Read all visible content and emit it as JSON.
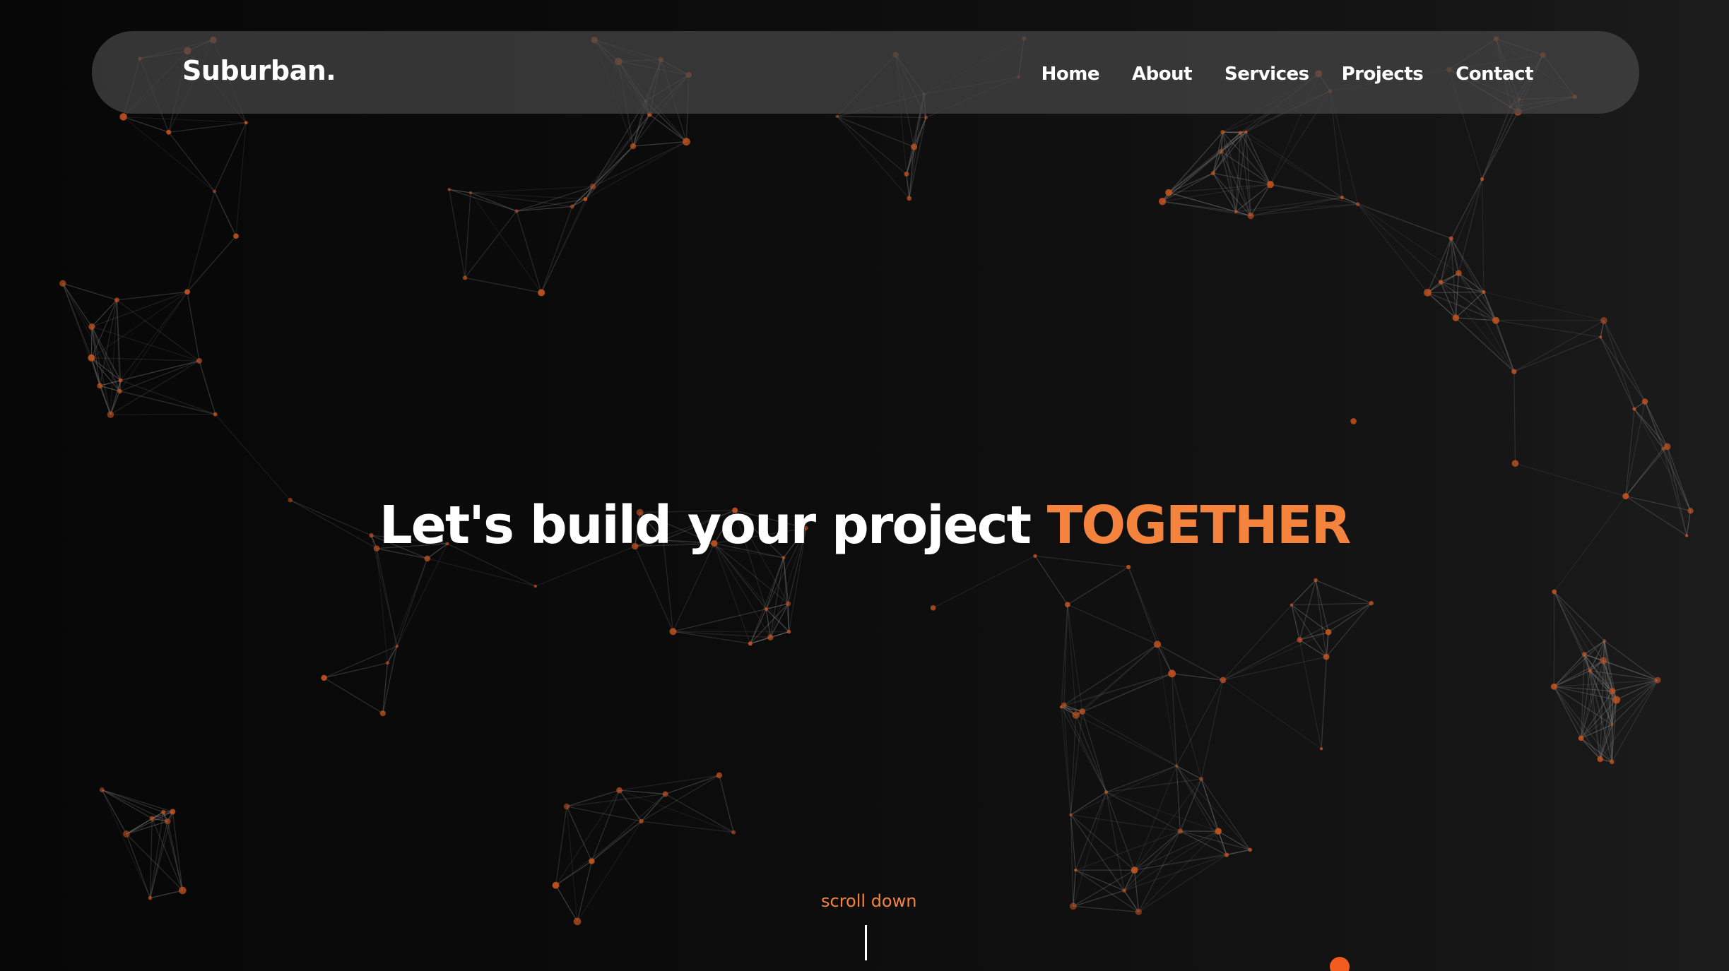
{
  "header": {
    "logo": "Suburban.",
    "nav": [
      {
        "label": "Home"
      },
      {
        "label": "About"
      },
      {
        "label": "Services"
      },
      {
        "label": "Projects"
      },
      {
        "label": "Contact"
      }
    ]
  },
  "hero": {
    "headline": "Let's build your project",
    "highlight": "TOGETHER"
  },
  "scroll": {
    "label": "scroll down"
  },
  "colors": {
    "accent": "#f4833d",
    "background": "#0a0a0a",
    "navbar": "#464646",
    "text": "#ffffff",
    "network_line": "#8a8a8a",
    "network_node": "#c2521f"
  }
}
